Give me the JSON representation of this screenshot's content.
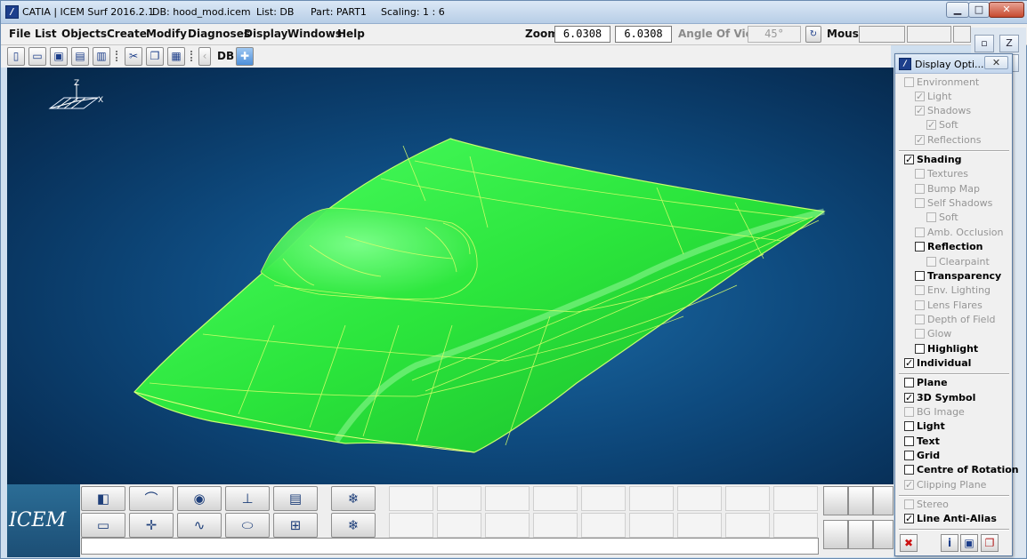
{
  "title_bar": {
    "app": "CATIA | ICEM Surf 2016.2.1",
    "db": "DB: hood_mod.icem",
    "list": "List: DB",
    "part": "Part: PART1",
    "scaling": "Scaling: 1 : 6",
    "minimize": "▁",
    "maximize": "□",
    "close": "✕"
  },
  "menu": {
    "items": [
      "File",
      "List",
      "Objects",
      "Create",
      "Modify",
      "Diagnoses",
      "Display",
      "Windows",
      "Help"
    ],
    "zoom_label": "Zoom",
    "zoom_value": "6.0308",
    "zoom_value2": "6.0308",
    "angle_label": "Angle Of View",
    "angle_value": "45°",
    "mouse_label": "Mouse"
  },
  "toolbar": {
    "db_label": "DB"
  },
  "viewport": {
    "axis_z": "Z",
    "axis_x": "X",
    "surface_color": "#2ee83e",
    "edge_color": "#d8ff6a",
    "background": "#0d4677"
  },
  "bottom": {
    "brand": "ICEM",
    "empty_slots": 9
  },
  "display_options": {
    "title": "Display Opti...",
    "groups": [
      [
        {
          "label": "Environment",
          "checked": false,
          "enabled": false,
          "indent": 0,
          "bold": false
        },
        {
          "label": "Light",
          "checked": true,
          "enabled": false,
          "indent": 1,
          "bold": false
        },
        {
          "label": "Shadows",
          "checked": true,
          "enabled": false,
          "indent": 1,
          "bold": false
        },
        {
          "label": "Soft",
          "checked": true,
          "enabled": false,
          "indent": 2,
          "bold": false
        },
        {
          "label": "Reflections",
          "checked": true,
          "enabled": false,
          "indent": 1,
          "bold": false
        }
      ],
      [
        {
          "label": "Shading",
          "checked": true,
          "enabled": true,
          "indent": 0,
          "bold": true
        },
        {
          "label": "Textures",
          "checked": false,
          "enabled": false,
          "indent": 1,
          "bold": false
        },
        {
          "label": "Bump Map",
          "checked": false,
          "enabled": false,
          "indent": 1,
          "bold": false
        },
        {
          "label": "Self Shadows",
          "checked": false,
          "enabled": false,
          "indent": 1,
          "bold": false
        },
        {
          "label": "Soft",
          "checked": false,
          "enabled": false,
          "indent": 2,
          "bold": false
        },
        {
          "label": "Amb. Occlusion",
          "checked": false,
          "enabled": false,
          "indent": 1,
          "bold": false
        },
        {
          "label": "Reflection",
          "checked": false,
          "enabled": true,
          "indent": 1,
          "bold": true
        },
        {
          "label": "Clearpaint",
          "checked": false,
          "enabled": false,
          "indent": 2,
          "bold": false
        },
        {
          "label": "Transparency",
          "checked": false,
          "enabled": true,
          "indent": 1,
          "bold": true
        },
        {
          "label": "Env. Lighting",
          "checked": false,
          "enabled": false,
          "indent": 1,
          "bold": false
        },
        {
          "label": "Lens Flares",
          "checked": false,
          "enabled": false,
          "indent": 1,
          "bold": false
        },
        {
          "label": "Depth of Field",
          "checked": false,
          "enabled": false,
          "indent": 1,
          "bold": false
        },
        {
          "label": "Glow",
          "checked": false,
          "enabled": false,
          "indent": 1,
          "bold": false
        },
        {
          "label": "Highlight",
          "checked": false,
          "enabled": true,
          "indent": 1,
          "bold": true
        },
        {
          "label": "Individual",
          "checked": true,
          "enabled": true,
          "indent": 0,
          "bold": true
        }
      ],
      [
        {
          "label": "Plane",
          "checked": false,
          "enabled": true,
          "indent": 0,
          "bold": true
        },
        {
          "label": "3D Symbol",
          "checked": true,
          "enabled": true,
          "indent": 0,
          "bold": true
        },
        {
          "label": "BG Image",
          "checked": false,
          "enabled": false,
          "indent": 0,
          "bold": false
        },
        {
          "label": "Light",
          "checked": false,
          "enabled": true,
          "indent": 0,
          "bold": true
        },
        {
          "label": "Text",
          "checked": false,
          "enabled": true,
          "indent": 0,
          "bold": true
        },
        {
          "label": "Grid",
          "checked": false,
          "enabled": true,
          "indent": 0,
          "bold": true
        },
        {
          "label": "Centre of Rotation",
          "checked": false,
          "enabled": true,
          "indent": 0,
          "bold": true
        },
        {
          "label": "Clipping Plane",
          "checked": true,
          "enabled": false,
          "indent": 0,
          "bold": false
        }
      ],
      [
        {
          "label": "Stereo",
          "checked": false,
          "enabled": false,
          "indent": 0,
          "bold": false
        },
        {
          "label": "Line Anti-Alias",
          "checked": true,
          "enabled": true,
          "indent": 0,
          "bold": true
        }
      ]
    ]
  }
}
